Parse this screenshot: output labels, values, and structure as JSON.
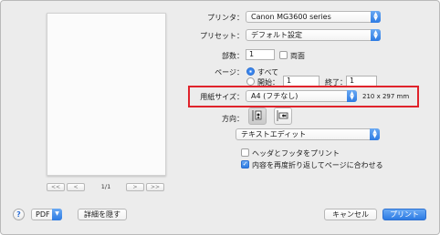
{
  "printer": {
    "label": "プリンタ：",
    "value": "Canon MG3600 series"
  },
  "preset": {
    "label": "プリセット：",
    "value": "デフォルト設定"
  },
  "copies": {
    "label": "部数：",
    "value": "1",
    "duplex_label": "両面"
  },
  "pages": {
    "label": "ページ：",
    "all_label": "すべて",
    "from_label": "開始：",
    "from_value": "1",
    "to_label": "終了：",
    "to_value": "1"
  },
  "paper_size": {
    "label": "用紙サイズ：",
    "value": "A4 (フチなし)",
    "dimensions": "210 x 297 mm"
  },
  "orientation": {
    "label": "方向："
  },
  "app_section": {
    "value": "テキストエディット"
  },
  "options": {
    "header_footer_label": "ヘッダとフッタをプリント",
    "rewrap_label": "内容を再度折り返してページに合わせる"
  },
  "preview": {
    "page_indicator": "1/1",
    "first": "<<",
    "prev": "<",
    "next": ">",
    "last": ">>"
  },
  "bottom": {
    "help": "?",
    "pdf_label": "PDF",
    "hide_details": "詳細を隠す",
    "cancel": "キャンセル",
    "print": "プリント"
  },
  "colors": {
    "accent": "#2d7be3",
    "highlight": "#e0232b"
  }
}
